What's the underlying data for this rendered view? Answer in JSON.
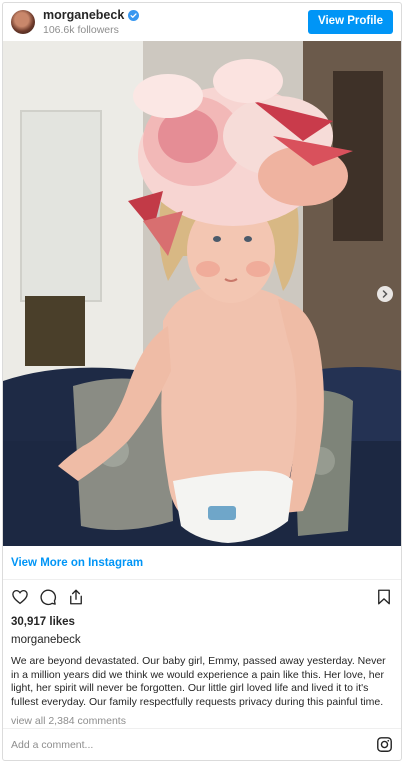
{
  "header": {
    "username": "morganebeck",
    "followers": "106.6k followers",
    "view_profile_label": "View Profile"
  },
  "post": {
    "view_more_label": "View More on Instagram",
    "likes": "30,917 likes",
    "caption_username": "morganebeck",
    "caption_text": "We are beyond devastated. Our baby girl, Emmy, passed away yesterday. Never in a million years did we think we would experience a pain like this. Her love, her light, her spirit will never be forgotten. Our little girl loved life and lived it to it's fullest everyday. Our family respectfully requests privacy during this painful time.",
    "view_comments_label": "view all 2,384 comments"
  },
  "comment": {
    "placeholder": "Add a comment..."
  },
  "colors": {
    "accent": "#0095f6",
    "secondary_text": "#8e8e8e",
    "border": "#dbdbdb"
  },
  "icons": [
    "verified-badge-icon",
    "chevron-right-icon",
    "heart-icon",
    "comment-icon",
    "share-icon",
    "bookmark-icon",
    "instagram-logo-icon"
  ]
}
